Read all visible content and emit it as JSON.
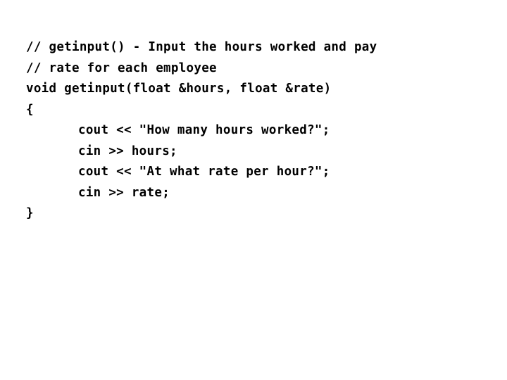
{
  "document": {
    "kind": "code-slide",
    "language": "C++",
    "background_color": "#ffffff",
    "text_color": "#000000"
  },
  "code": {
    "lines": [
      {
        "text": "// getinput() - Input the hours worked and pay",
        "indent": 0
      },
      {
        "text": "// rate for each employee",
        "indent": 0
      },
      {
        "text": "void getinput(float &hours, float &rate)",
        "indent": 0
      },
      {
        "text": "{",
        "indent": 0
      },
      {
        "text": "cout << \"How many hours worked?\";",
        "indent": 1
      },
      {
        "text": "cin >> hours;",
        "indent": 1
      },
      {
        "text": "cout << \"At what rate per hour?\";",
        "indent": 1
      },
      {
        "text": "cin >> rate;",
        "indent": 1
      },
      {
        "text": "}",
        "indent": 0
      }
    ]
  }
}
